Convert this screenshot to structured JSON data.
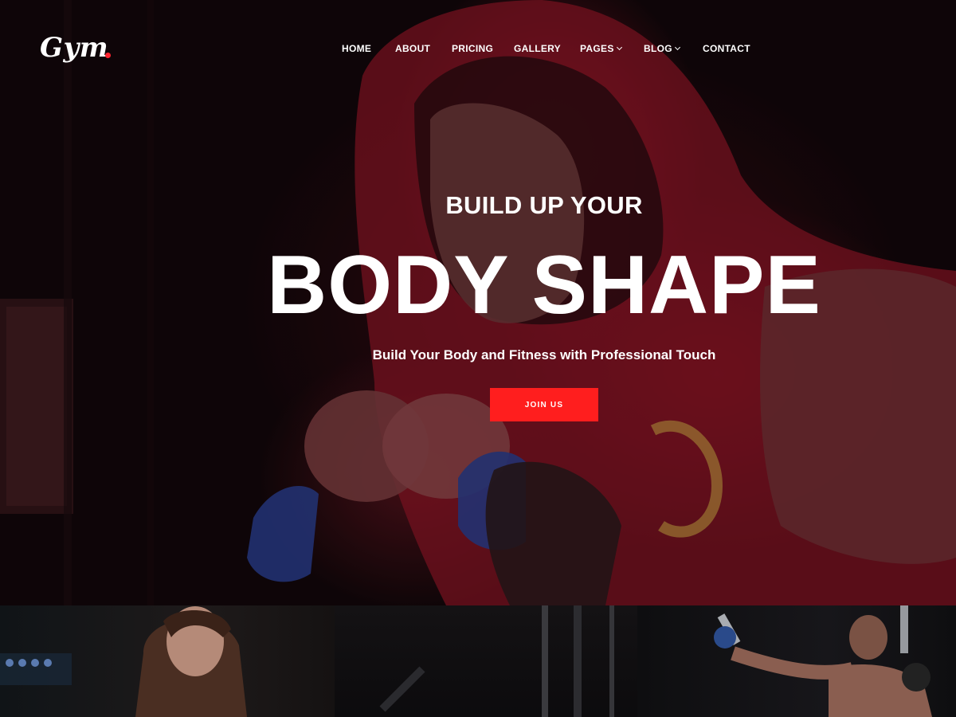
{
  "brand": {
    "logo_text": "Gym"
  },
  "nav": {
    "items": [
      {
        "label": "HOME",
        "has_dropdown": false
      },
      {
        "label": "ABOUT",
        "has_dropdown": false
      },
      {
        "label": "PRICING",
        "has_dropdown": false
      },
      {
        "label": "GALLERY",
        "has_dropdown": false
      },
      {
        "label": "PAGES",
        "has_dropdown": true
      },
      {
        "label": "BLOG",
        "has_dropdown": true
      },
      {
        "label": "CONTACT",
        "has_dropdown": false
      }
    ]
  },
  "hero": {
    "subtitle": "BUILD UP YOUR",
    "title": "BODY SHAPE",
    "tagline": "Build Your Body and Fitness with Professional Touch",
    "cta_label": "JOIN US"
  },
  "colors": {
    "accent": "#ff1e1e",
    "logo_dot": "#ff2530",
    "hero_tint": "#3a0a14"
  },
  "icons": {
    "dropdown": "chevron-down-icon"
  }
}
